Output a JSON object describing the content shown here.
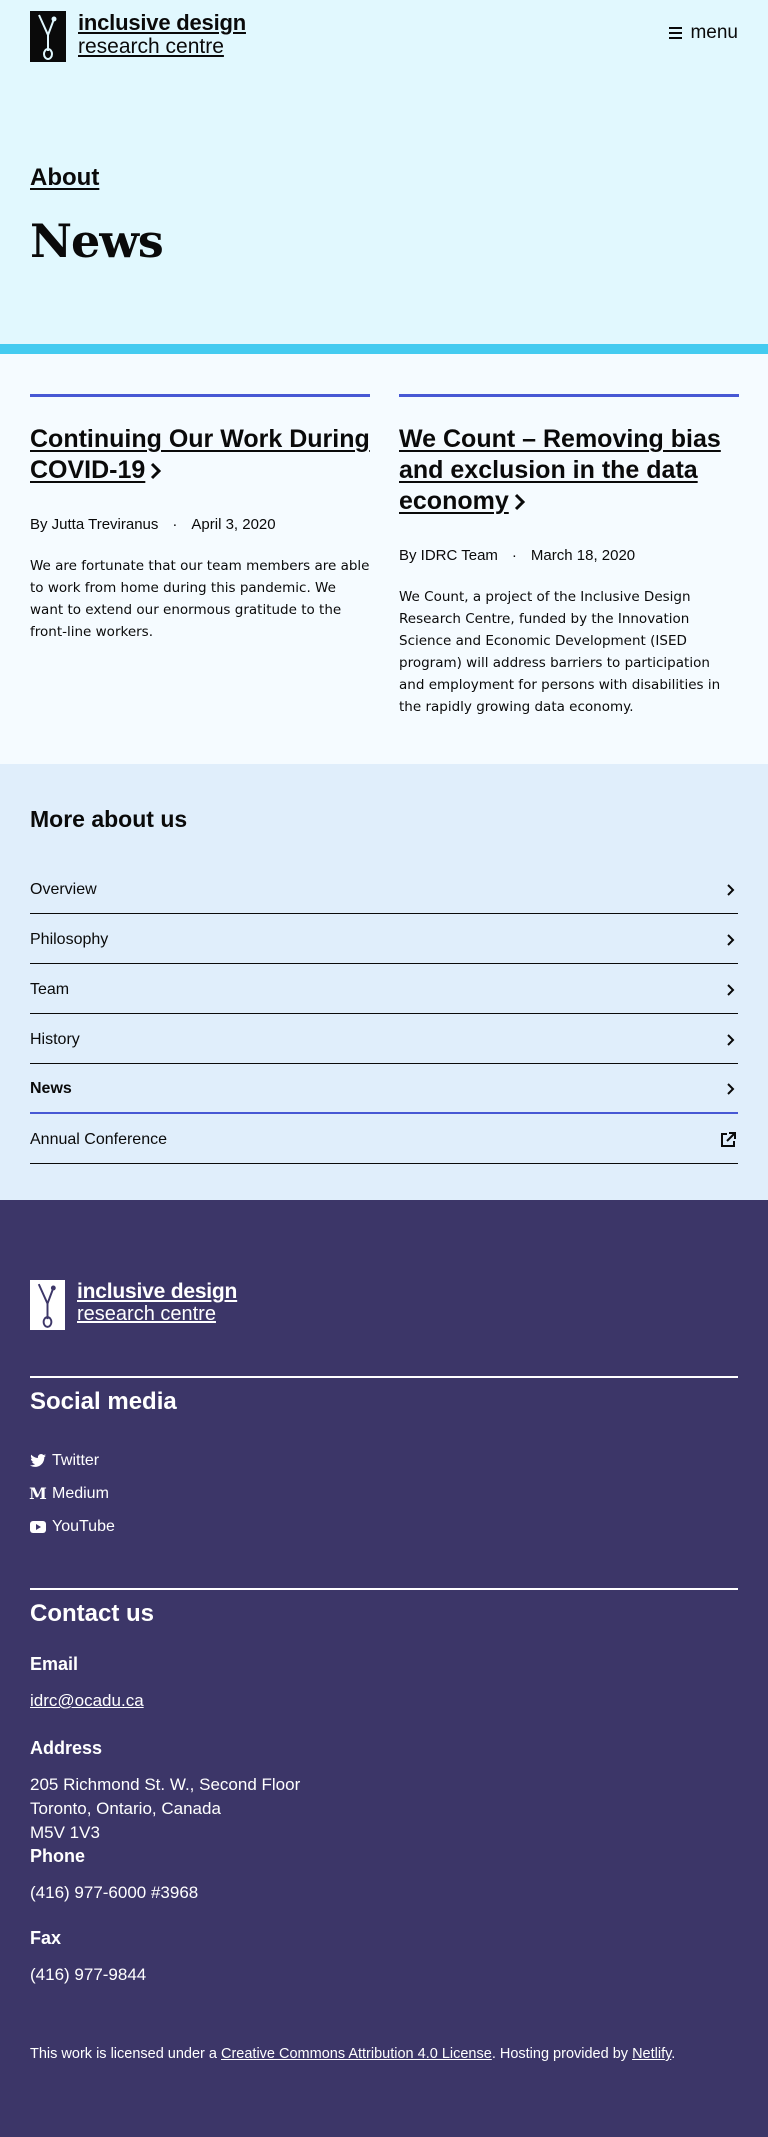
{
  "header": {
    "logo_line1": "inclusive design",
    "logo_line2": "research centre",
    "menu_label": "menu"
  },
  "hero": {
    "breadcrumb": "About",
    "title": "News"
  },
  "news": [
    {
      "title": "Continuing Our Work During COVID-19",
      "author": "By Jutta Treviranus",
      "date": "April 3, 2020",
      "excerpt": "We are fortunate that our team members are able to work from home during this pandemic. We want to extend our enormous gratitude to the front-line workers."
    },
    {
      "title": "We Count – Removing bias and exclusion in the data economy",
      "author": "By IDRC Team",
      "date": "March 18, 2020",
      "excerpt": "We Count, a project of the Inclusive Design Research Centre, funded by the Innovation Science and Economic Development (ISED program) will address barriers to participation and employment for persons with disabilities in the rapidly growing data economy."
    }
  ],
  "more": {
    "title": "More about us",
    "items": [
      {
        "label": "Overview",
        "icon": "chevron-right-icon"
      },
      {
        "label": "Philosophy",
        "icon": "chevron-right-icon"
      },
      {
        "label": "Team",
        "icon": "chevron-right-icon"
      },
      {
        "label": "History",
        "icon": "chevron-right-icon"
      },
      {
        "label": "News",
        "icon": "chevron-right-icon",
        "active": true
      },
      {
        "label": "Annual Conference",
        "icon": "external-link-icon"
      }
    ]
  },
  "footer": {
    "logo_line1": "inclusive design",
    "logo_line2": "research centre",
    "social_title": "Social media",
    "social": [
      {
        "label": "Twitter",
        "icon": "twitter-icon"
      },
      {
        "label": "Medium",
        "icon": "medium-icon"
      },
      {
        "label": "YouTube",
        "icon": "youtube-icon"
      }
    ],
    "contact_title": "Contact us",
    "email_label": "Email",
    "email": "idrc@ocadu.ca",
    "address_label": "Address",
    "address_line1": "205 Richmond St. W., Second Floor",
    "address_line2": "Toronto, Ontario, Canada",
    "address_line3": "M5V 1V3",
    "phone_label": "Phone",
    "phone": "(416) 977-6000 #3968",
    "fax_label": "Fax",
    "fax": "(416) 977-9844",
    "license_prefix": "This work is licensed under a ",
    "license_link": "Creative Commons Attribution 4.0 License",
    "license_mid": ". Hosting provided by ",
    "host_link": "Netlify",
    "license_suffix": "."
  },
  "colors": {
    "hero_bg": "#e1f8fe",
    "stripe": "#44cbf0",
    "accent": "#4758d4",
    "more_bg": "#e0eefb",
    "footer_bg": "#3c3668"
  }
}
